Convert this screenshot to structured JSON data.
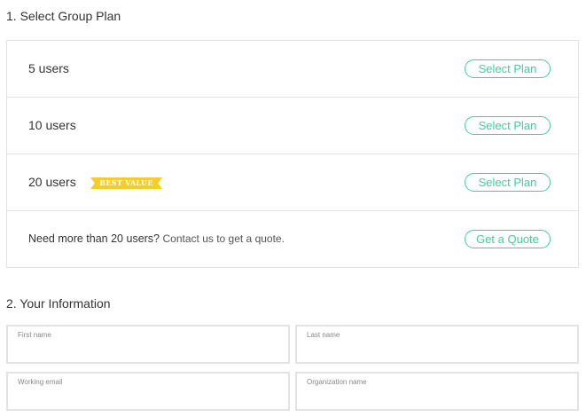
{
  "sections": {
    "plan_title": "1. Select Group Plan",
    "info_title": "2. Your Information"
  },
  "plans": [
    {
      "label": "5 users",
      "button": "Select Plan"
    },
    {
      "label": "10 users",
      "button": "Select Plan"
    },
    {
      "label": "20 users",
      "button": "Select Plan",
      "badge": "BEST VALUE"
    }
  ],
  "quote": {
    "text": "Need more than 20 users?",
    "contact": "Contact us to get a quote.",
    "button": "Get a Quote"
  },
  "form": {
    "first_name": {
      "label": "First name",
      "value": ""
    },
    "last_name": {
      "label": "Last name",
      "value": ""
    },
    "email": {
      "label": "Working email",
      "value": ""
    },
    "organization": {
      "label": "Organization name",
      "value": ""
    }
  },
  "colors": {
    "accent": "#3ecf9a",
    "badge": "#f5cb2e",
    "border": "#e3e3e3"
  }
}
